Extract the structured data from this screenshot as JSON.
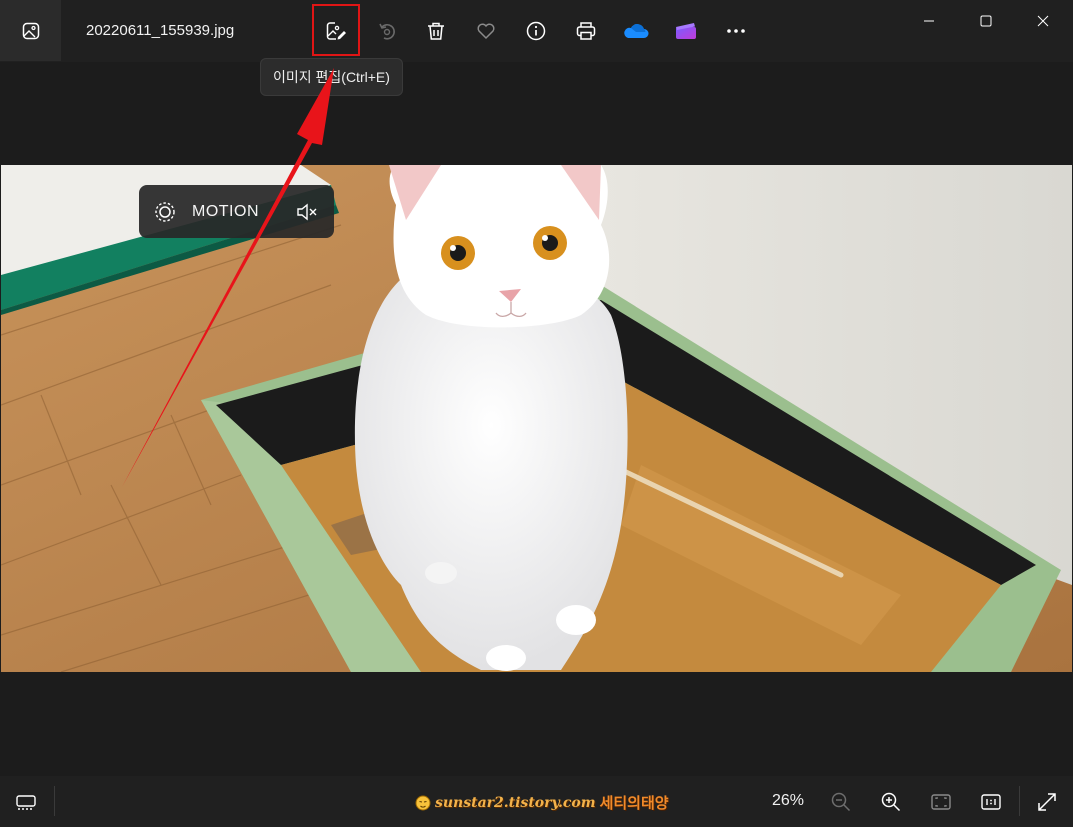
{
  "header": {
    "file_name": "20220611_155939.jpg",
    "tooltip": "이미지 편집(Ctrl+E)",
    "toolbar_icons": [
      "edit-image-icon",
      "rotate-icon",
      "delete-icon",
      "favorite-icon",
      "info-icon",
      "print-icon",
      "onedrive-icon",
      "clipchamp-icon",
      "more-icon"
    ]
  },
  "motion": {
    "label": "MOTION",
    "icon": "live-photo-icon",
    "mute_icon": "mute-icon"
  },
  "footer": {
    "zoom": "26%",
    "watermark_en": "sunstar2.tistory.com",
    "watermark_ko": "세티의태양"
  },
  "colors": {
    "highlight": "#e01515",
    "background": "#1c1c1c",
    "bar": "#202020"
  }
}
